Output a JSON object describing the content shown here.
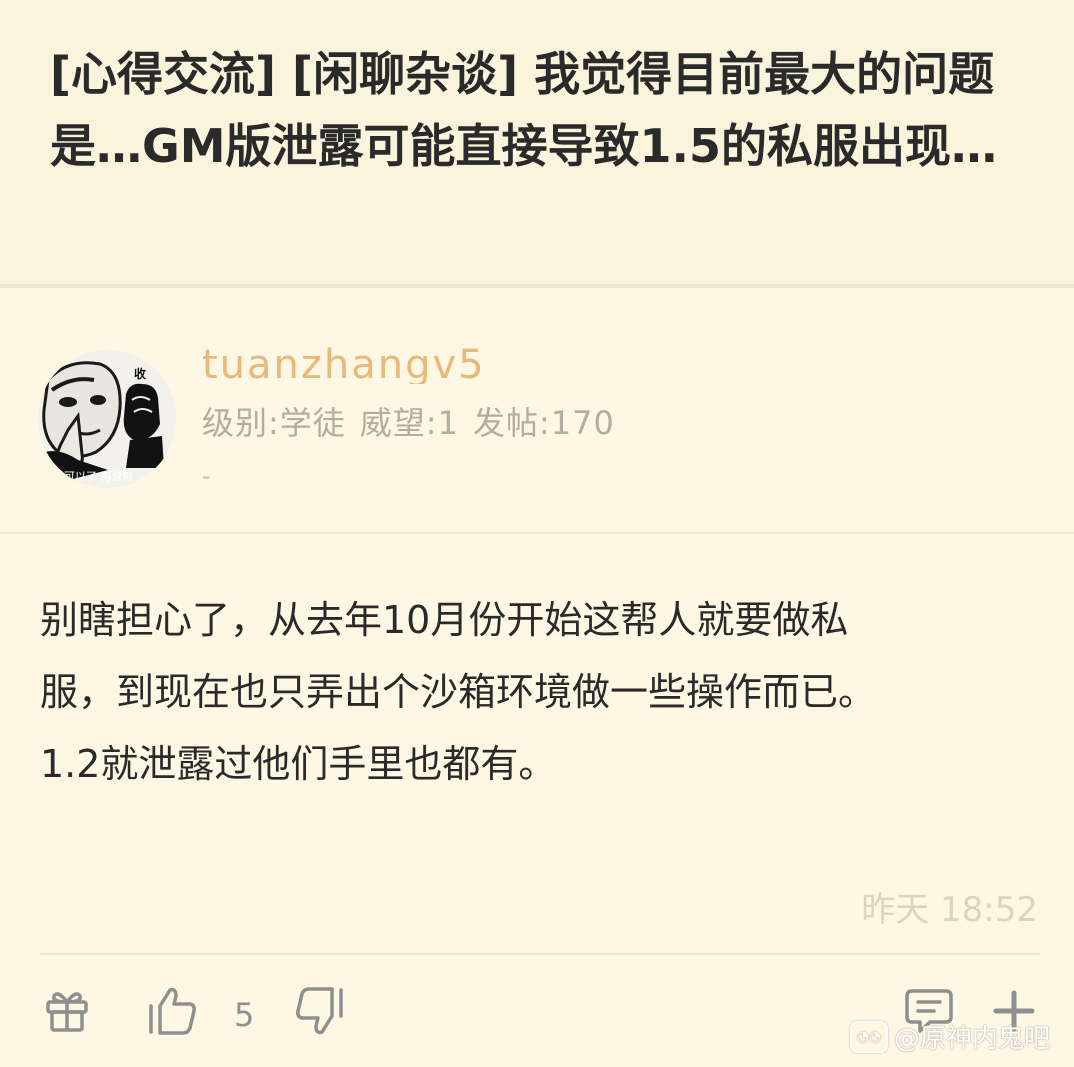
{
  "post": {
    "title": "[心得交流] [闲聊杂谈] 我觉得目前最大的问题是…GM版泄露可能直接导致1.5的私服出现…"
  },
  "author": {
    "username": "tuanzhangv5",
    "level": "级别:学徒",
    "prestige": "威望:1",
    "posts": "发帖:170",
    "signature": "-",
    "avatar_caption_top": "收",
    "avatar_caption_bottom": "可以了 再说就"
  },
  "content": {
    "lines": [
      "别瞎担心了，从去年10月份开始这帮人就要做私",
      "服，到现在也只弄出个沙箱环境做一些操作而已。",
      "1.2就泄露过他们手里也都有。"
    ]
  },
  "timestamp": "昨天 18:52",
  "actions": {
    "gift_icon": "gift-icon",
    "like_icon": "thumbs-up-icon",
    "like_count": "5",
    "dislike_icon": "thumbs-down-icon",
    "comment_icon": "comment-icon",
    "more_icon": "plus-icon"
  },
  "watermark": "@原神内鬼吧",
  "colors": {
    "background": "#fdf7e3",
    "username": "#e8b97a",
    "meta": "#b2ad9f",
    "timestamp": "#ddd4bd"
  }
}
